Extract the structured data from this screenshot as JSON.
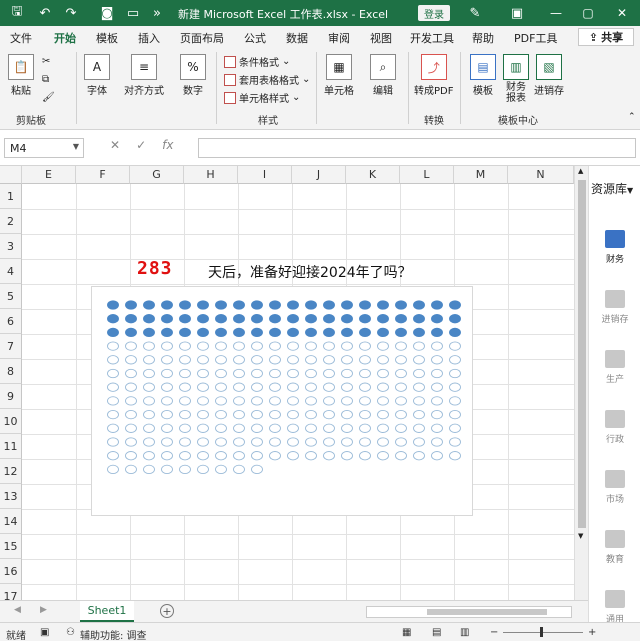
{
  "titlebar": {
    "title": "新建 Microsoft Excel 工作表.xlsx  -  Excel",
    "login": "登录",
    "minimize": "—",
    "restore": "▢",
    "close": "✕"
  },
  "menu": {
    "tabs": [
      "文件",
      "开始",
      "模板",
      "插入",
      "页面布局",
      "公式",
      "数据",
      "审阅",
      "视图",
      "开发工具",
      "帮助",
      "PDF工具"
    ],
    "active": "开始",
    "share": "共享"
  },
  "ribbon": {
    "paste": "粘贴",
    "clipboard": "剪贴板",
    "font": "字体",
    "align": "对齐方式",
    "number": "数字",
    "cond_format": "条件格式",
    "table_format": "套用表格格式",
    "cell_style": "单元格样式",
    "style_group": "样式",
    "cells": "单元格",
    "edit": "编辑",
    "to_pdf": "转成PDF",
    "convert_group": "转换",
    "template": "模板",
    "finance_report": "财务报表",
    "inventory": "进销存",
    "template_center": "模板中心"
  },
  "formula": {
    "namebox": "M4",
    "value": ""
  },
  "grid": {
    "columns": [
      "E",
      "F",
      "G",
      "H",
      "I",
      "J",
      "K",
      "L",
      "M",
      "N"
    ],
    "rows": [
      "1",
      "2",
      "3",
      "4",
      "5",
      "6",
      "7",
      "8",
      "9",
      "10",
      "11",
      "12",
      "13",
      "14",
      "15",
      "16",
      "17"
    ]
  },
  "content": {
    "count": "283",
    "headline": "天后，准备好迎接2024年了吗？",
    "dots_total": 249,
    "dots_filled": 60,
    "dots_per_row": 20,
    "filled_color": "#4a86c5",
    "empty_color": "#9bbbd8"
  },
  "sidepanel": {
    "title": "资源库",
    "items": [
      "财务",
      "进销存",
      "生产",
      "行政",
      "市场",
      "教育",
      "通用"
    ]
  },
  "sheets": {
    "active": "Sheet1"
  },
  "status": {
    "ready": "就绪",
    "accessibility": "辅助功能: 调查",
    "zoom_minus": "−",
    "zoom_plus": "+"
  }
}
